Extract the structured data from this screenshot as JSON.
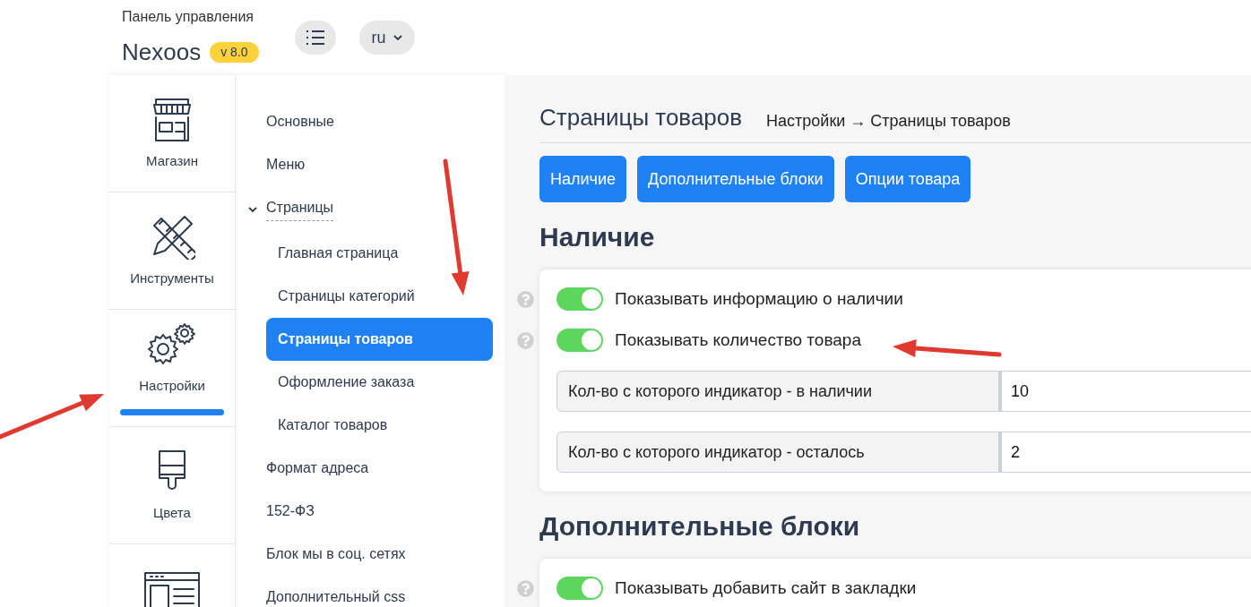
{
  "header": {
    "subtitle": "Панель управления",
    "brand": "Nexoos",
    "version": "v 8.0",
    "language": "ru"
  },
  "rail": [
    {
      "label": "Магазин",
      "selected": false
    },
    {
      "label": "Инструменты",
      "selected": false
    },
    {
      "label": "Настройки",
      "selected": true
    },
    {
      "label": "Цвета",
      "selected": false
    }
  ],
  "menu": [
    {
      "label": "Основные",
      "selected": false
    },
    {
      "label": "Меню",
      "selected": false
    },
    {
      "label": "Страницы",
      "selected": false,
      "expanded": true,
      "children": [
        {
          "label": "Главная страница",
          "selected": false
        },
        {
          "label": "Страницы категорий",
          "selected": false
        },
        {
          "label": "Страницы товаров",
          "selected": true
        },
        {
          "label": "Оформление заказа",
          "selected": false
        },
        {
          "label": "Каталог товаров",
          "selected": false
        }
      ]
    },
    {
      "label": "Формат адреса",
      "selected": false
    },
    {
      "label": "152-ФЗ",
      "selected": false
    },
    {
      "label": "Блок мы в соц. сетях",
      "selected": false
    },
    {
      "label": "Дополнительный css",
      "selected": false
    }
  ],
  "page": {
    "title": "Страницы товаров",
    "breadcrumb": "Настройки → Страницы товаров",
    "buttons": [
      "Наличие",
      "Дополнительные блоки",
      "Опции товара"
    ],
    "sections": [
      {
        "title": "Наличие",
        "rows": [
          {
            "kind": "toggle",
            "label": "Показывать информацию о наличии",
            "on": true
          },
          {
            "kind": "toggle",
            "label": "Показывать количество товара",
            "on": true
          },
          {
            "kind": "input",
            "label": "Кол-во с которого индикатор - в наличии",
            "value": "10"
          },
          {
            "kind": "input",
            "label": "Кол-во с которого индикатор - осталось",
            "value": "2"
          }
        ]
      },
      {
        "title": "Дополнительные блоки",
        "rows": [
          {
            "kind": "toggle",
            "label": "Показывать добавить сайт в закладки",
            "on": true
          }
        ]
      }
    ]
  }
}
